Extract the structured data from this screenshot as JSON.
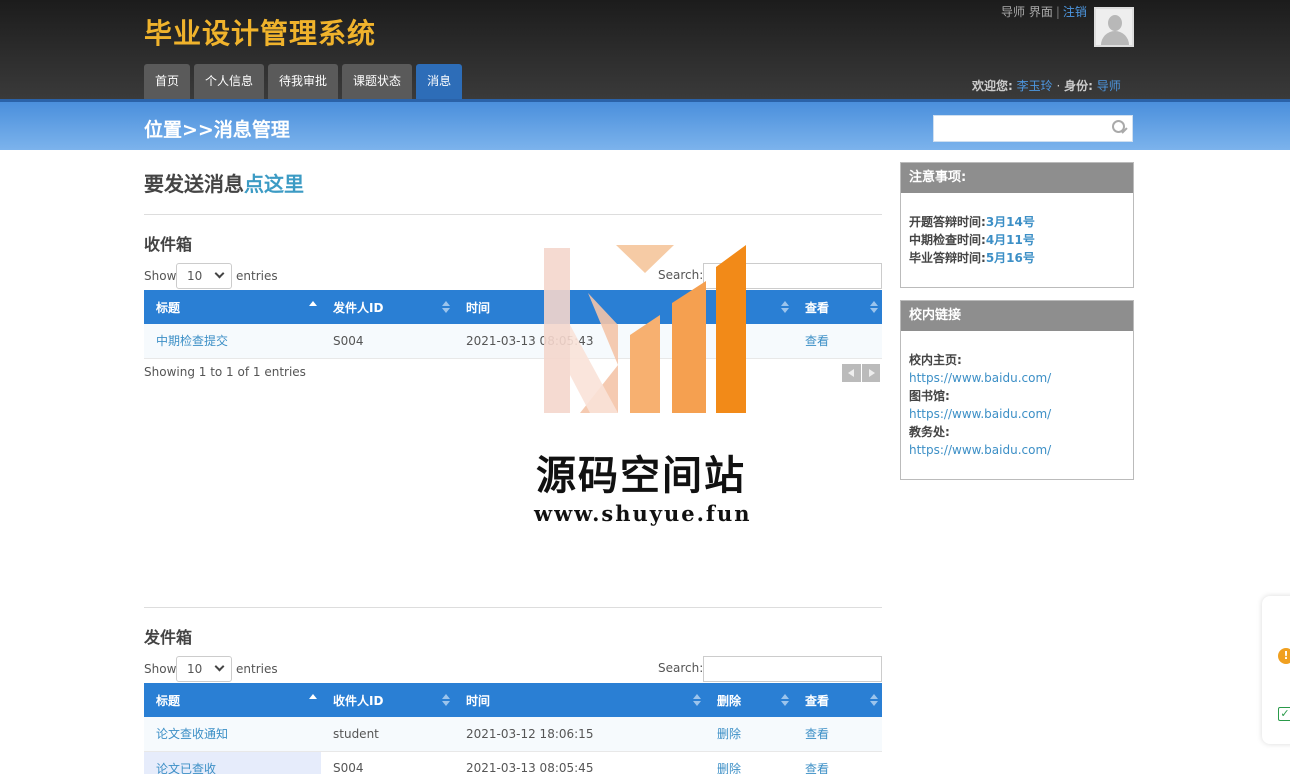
{
  "header": {
    "logo": "毕业设计管理系统",
    "nav": [
      "首页",
      "个人信息",
      "待我审批",
      "课题状态",
      "消息"
    ],
    "active_nav": "消息",
    "role_link_text": "导师 界面",
    "logout": "注销",
    "welcome_label": "欢迎您:",
    "user_name": "李玉玲",
    "identity_label": "身份:",
    "identity": "导师"
  },
  "location": {
    "title": "位置>>消息管理",
    "search_value": ""
  },
  "send": {
    "prefix": "要发送消息",
    "link": "点这里"
  },
  "inbox": {
    "title": "收件箱",
    "show": "Show",
    "length": "10",
    "entries": "entries",
    "search_label": "Search:",
    "columns": [
      "标题",
      "发件人ID",
      "时间",
      "",
      "查看"
    ],
    "rows": [
      {
        "title": "中期检查提交",
        "sender": "S004",
        "time": "2021-03-13 08:05:43",
        "view": "查看"
      }
    ],
    "info": "Showing 1 to 1 of 1 entries"
  },
  "outbox": {
    "title": "发件箱",
    "show": "Show",
    "length": "10",
    "entries": "entries",
    "search_label": "Search:",
    "columns": [
      "标题",
      "收件人ID",
      "时间",
      "删除",
      "查看"
    ],
    "rows": [
      {
        "title": "论文查收通知",
        "receiver": "student",
        "time": "2021-03-12 18:06:15",
        "delete": "删除",
        "view": "查看"
      },
      {
        "title": "论文已查收",
        "receiver": "S004",
        "time": "2021-03-13 08:05:45",
        "delete": "删除",
        "view": "查看"
      }
    ]
  },
  "notice": {
    "title": "注意事项:",
    "items": [
      {
        "label": "开题答辩时间:",
        "value": "3月14号"
      },
      {
        "label": "中期检查时间:",
        "value": "4月11号"
      },
      {
        "label": "毕业答辩时间:",
        "value": "5月16号"
      }
    ]
  },
  "links": {
    "title": "校内链接",
    "items": [
      {
        "label": "校内主页:",
        "url": "https://www.baidu.com/"
      },
      {
        "label": "图书馆:",
        "url": "https://www.baidu.com/"
      },
      {
        "label": "教务处:",
        "url": "https://www.baidu.com/"
      }
    ]
  },
  "watermark": {
    "name": "源码空间站",
    "url": "www.shuyue.fun"
  },
  "colors": {
    "logo": "#f0b32c",
    "nav_active": "#2d6db8",
    "table_header": "#2a7fd4",
    "link": "#3c8fc6",
    "watermark_orange": "#f5a050"
  }
}
